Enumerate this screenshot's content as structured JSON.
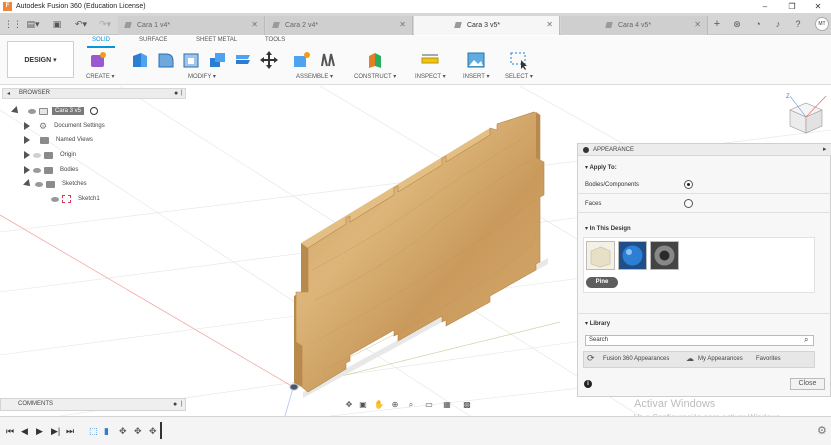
{
  "window": {
    "app_icon_letter": "F",
    "title": "Autodesk Fusion 360 (Education License)",
    "minimize": "–",
    "restore": "❐",
    "close": "✕"
  },
  "quick_access": {
    "grid_icon": "grid-icon",
    "file_icon": "file-icon",
    "save_icon": "save-icon",
    "undo_icon": "undo-icon",
    "redo_icon": "redo-icon"
  },
  "tabs": [
    {
      "label": "Cara 1 v4*",
      "active": false
    },
    {
      "label": "Cara 2 v4*",
      "active": false
    },
    {
      "label": "Cara 3 v5*",
      "active": true
    },
    {
      "label": "Cara 4 v5*",
      "active": false
    }
  ],
  "tab_close": "✕",
  "tab_add": "+",
  "user_initials": "MT",
  "ribbon": {
    "workspace": "DESIGN ▾",
    "tabs": [
      "SOLID",
      "SURFACE",
      "SHEET METAL",
      "TOOLS"
    ],
    "groups": [
      "CREATE ▾",
      "MODIFY ▾",
      "ASSEMBLE ▾",
      "CONSTRUCT ▾",
      "INSPECT ▾",
      "INSERT ▾",
      "SELECT ▾"
    ]
  },
  "browser": {
    "title": "BROWSER",
    "items": [
      {
        "label": "Cara 3 v5"
      },
      {
        "label": "Document Settings"
      },
      {
        "label": "Named Views"
      },
      {
        "label": "Origin"
      },
      {
        "label": "Bodies"
      },
      {
        "label": "Sketches"
      },
      {
        "label": "Sketch1"
      }
    ]
  },
  "comments": {
    "title": "COMMENTS"
  },
  "appearance": {
    "title": "APPEARANCE",
    "apply_to": "Apply To:",
    "option_bodies": "Bodies/Components",
    "option_faces": "Faces",
    "in_this_design": "In This Design",
    "material_tag": "Pine",
    "library": "Library",
    "search_placeholder": "Search",
    "lib_tabs": [
      "Fusion 360 Appearances",
      "My Appearances",
      "Favorites"
    ],
    "close": "Close",
    "info": "i"
  },
  "watermark": {
    "line1": "Activar Windows",
    "line2": "Ve a Configuración para activar Windows."
  },
  "viewcube_axis": "Z",
  "colors": {
    "accent": "#0696d7",
    "wood_light": "#d9b074",
    "wood_dark": "#b88a4e"
  }
}
